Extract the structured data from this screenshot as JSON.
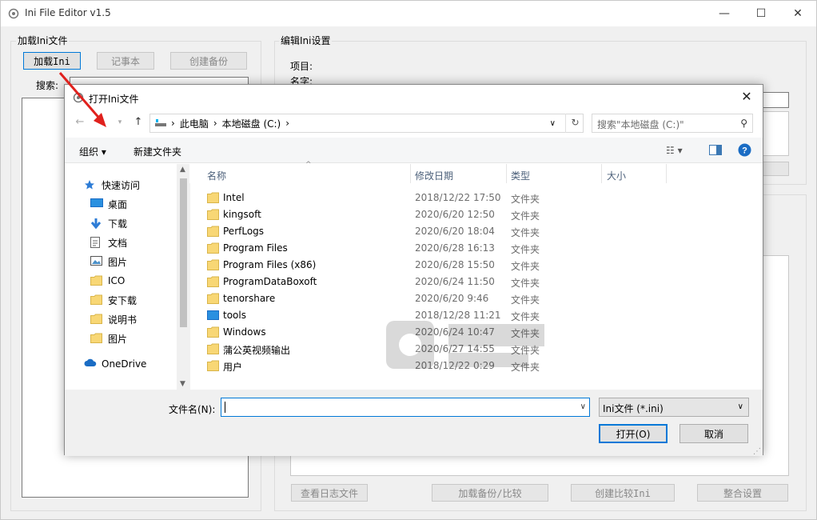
{
  "window": {
    "title": "Ini File Editor v1.5",
    "minimize": "—",
    "maximize": "☐",
    "close": "✕"
  },
  "left_panel": {
    "group_title": "加载Ini文件",
    "load_button": "加载Ini",
    "notepad_button": "记事本",
    "backup_button": "创建备份",
    "search_label": "搜索:"
  },
  "right_panel": {
    "group_title": "编辑Ini设置",
    "section_label": "项目:",
    "name_label": "名字:",
    "apply_button_partial": "止",
    "bottom_buttons": [
      "查看日志文件",
      "加载备份/比较",
      "创建比较Ini",
      "整合设置"
    ]
  },
  "dialog": {
    "title": "打开Ini文件",
    "close": "✕",
    "breadcrumb": [
      "此电脑",
      "本地磁盘 (C:)"
    ],
    "search_placeholder": "搜索\"本地磁盘 (C:)\"",
    "organize": "组织 ▾",
    "new_folder": "新建文件夹",
    "nav_items": [
      {
        "label": "快速访问",
        "icon": "star-icon",
        "pinned": false
      },
      {
        "label": "桌面",
        "icon": "desktop-icon",
        "pinned": true
      },
      {
        "label": "下载",
        "icon": "download-icon",
        "pinned": true
      },
      {
        "label": "文档",
        "icon": "document-icon",
        "pinned": true
      },
      {
        "label": "图片",
        "icon": "picture-icon",
        "pinned": true
      },
      {
        "label": "ICO",
        "icon": "folder-icon",
        "pinned": false
      },
      {
        "label": "安下载",
        "icon": "folder-icon",
        "pinned": false
      },
      {
        "label": "说明书",
        "icon": "folder-icon",
        "pinned": false
      },
      {
        "label": "图片",
        "icon": "folder-icon",
        "pinned": false
      },
      {
        "label": "OneDrive",
        "icon": "cloud-icon",
        "pinned": false
      }
    ],
    "columns": [
      "名称",
      "修改日期",
      "类型",
      "大小"
    ],
    "files": [
      {
        "name": "Intel",
        "date": "2018/12/22 17:50",
        "type": "文件夹"
      },
      {
        "name": "kingsoft",
        "date": "2020/6/20 12:50",
        "type": "文件夹"
      },
      {
        "name": "PerfLogs",
        "date": "2020/6/20 18:04",
        "type": "文件夹"
      },
      {
        "name": "Program Files",
        "date": "2020/6/28 16:13",
        "type": "文件夹"
      },
      {
        "name": "Program Files (x86)",
        "date": "2020/6/28 15:50",
        "type": "文件夹"
      },
      {
        "name": "ProgramDataBoxoft",
        "date": "2020/6/24 11:50",
        "type": "文件夹"
      },
      {
        "name": "tenorshare",
        "date": "2020/6/20 9:46",
        "type": "文件夹"
      },
      {
        "name": "tools",
        "date": "2018/12/28 11:21",
        "type": "文件夹"
      },
      {
        "name": "Windows",
        "date": "2020/6/24 10:47",
        "type": "文件夹"
      },
      {
        "name": "蒲公英视频输出",
        "date": "2020/6/27 14:55",
        "type": "文件夹"
      },
      {
        "name": "用户",
        "date": "2018/12/22 0:29",
        "type": "文件夹"
      }
    ],
    "filename_label": "文件名(N):",
    "filename_value": "",
    "filter": "Ini文件 (*.ini)",
    "open_button": "打开(O)",
    "cancel_button": "取消"
  },
  "colors": {
    "accent": "#0078d7",
    "folder": "#f8d775",
    "arrow": "#e0211d"
  }
}
